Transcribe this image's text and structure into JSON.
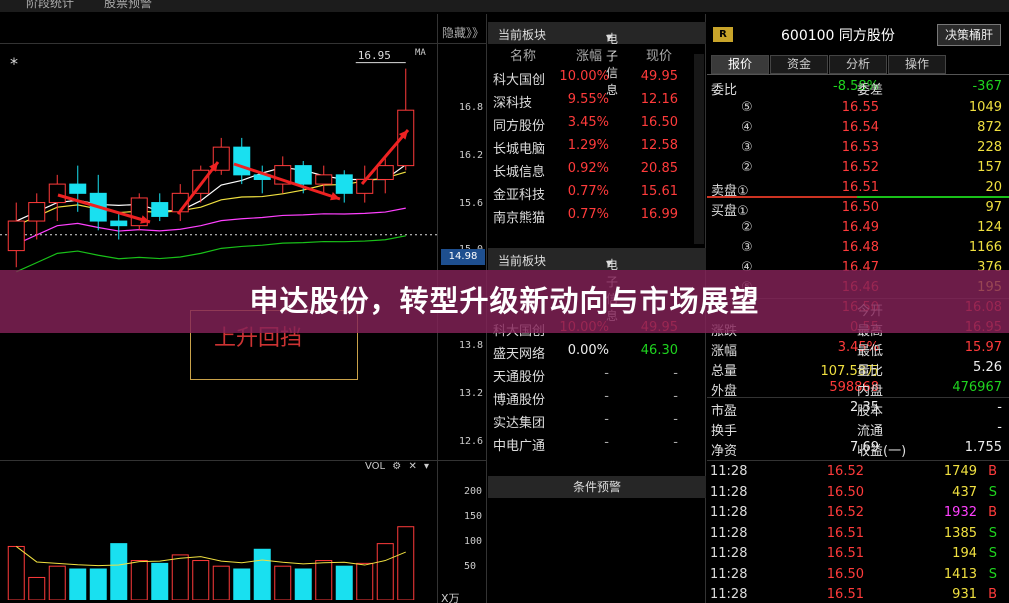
{
  "topbar": {
    "left": "阶段统计",
    "right": "股票预警"
  },
  "chart": {
    "hide_label": "隐藏》》",
    "ma_label": "MA",
    "star": "*",
    "peak_label": "16.95",
    "y_ticks": [
      "16.8",
      "16.2",
      "15.6",
      "15.0",
      "13.8",
      "13.2",
      "12.6"
    ],
    "price_flag": "14.98",
    "annotation": "上升回挡",
    "vol_label": "VOL",
    "vol_ticks": [
      "200",
      "150",
      "100",
      "50"
    ],
    "x_unit": "X万",
    "colors": {
      "up": "#ff3b3b",
      "down": "#19e0f0",
      "ma5": "#ffffff",
      "ma10": "#f0e040",
      "ma20": "#ff40ff",
      "ma60": "#19c019"
    }
  },
  "chart_data": {
    "type": "candlestick",
    "candles": [
      {
        "o": 14.98,
        "h": 15.5,
        "l": 14.8,
        "c": 15.3
      },
      {
        "o": 15.3,
        "h": 15.6,
        "l": 15.1,
        "c": 15.5
      },
      {
        "o": 15.5,
        "h": 15.8,
        "l": 15.3,
        "c": 15.7
      },
      {
        "o": 15.7,
        "h": 15.9,
        "l": 15.4,
        "c": 15.6
      },
      {
        "o": 15.6,
        "h": 15.8,
        "l": 15.2,
        "c": 15.3
      },
      {
        "o": 15.3,
        "h": 15.4,
        "l": 15.1,
        "c": 15.25
      },
      {
        "o": 15.25,
        "h": 15.6,
        "l": 15.2,
        "c": 15.55
      },
      {
        "o": 15.5,
        "h": 15.6,
        "l": 15.3,
        "c": 15.35
      },
      {
        "o": 15.4,
        "h": 15.7,
        "l": 15.3,
        "c": 15.6
      },
      {
        "o": 15.6,
        "h": 15.9,
        "l": 15.5,
        "c": 15.85
      },
      {
        "o": 15.85,
        "h": 16.2,
        "l": 15.8,
        "c": 16.1
      },
      {
        "o": 16.1,
        "h": 16.2,
        "l": 15.7,
        "c": 15.8
      },
      {
        "o": 15.8,
        "h": 15.9,
        "l": 15.6,
        "c": 15.75
      },
      {
        "o": 15.7,
        "h": 16.0,
        "l": 15.6,
        "c": 15.9
      },
      {
        "o": 15.9,
        "h": 15.95,
        "l": 15.6,
        "c": 15.7
      },
      {
        "o": 15.7,
        "h": 15.9,
        "l": 15.6,
        "c": 15.8
      },
      {
        "o": 15.8,
        "h": 15.85,
        "l": 15.5,
        "c": 15.6
      },
      {
        "o": 15.6,
        "h": 15.9,
        "l": 15.5,
        "c": 15.75
      },
      {
        "o": 15.75,
        "h": 16.0,
        "l": 15.6,
        "c": 15.9
      },
      {
        "o": 15.9,
        "h": 16.95,
        "l": 15.85,
        "c": 16.5
      }
    ],
    "volumes": [
      95,
      40,
      60,
      55,
      55,
      100,
      70,
      65,
      80,
      70,
      60,
      55,
      90,
      60,
      55,
      70,
      60,
      65,
      100,
      130
    ],
    "ylim": [
      14.9,
      17.0
    ],
    "vol_ylim": [
      0,
      220
    ]
  },
  "sector_top": {
    "header_left": "当前板块",
    "header_right": "电子信息",
    "columns": [
      "名称",
      "涨幅",
      "现价"
    ],
    "rows": [
      {
        "name": "科大国创",
        "chg": "10.00%",
        "price": "49.95"
      },
      {
        "name": "深科技",
        "chg": "9.55%",
        "price": "12.16"
      },
      {
        "name": "同方股份",
        "chg": "3.45%",
        "price": "16.50"
      },
      {
        "name": "长城电脑",
        "chg": "1.29%",
        "price": "12.58"
      },
      {
        "name": "长城信息",
        "chg": "0.92%",
        "price": "20.85"
      },
      {
        "name": "金亚科技",
        "chg": "0.77%",
        "price": "15.61"
      },
      {
        "name": "南京熊猫",
        "chg": "0.77%",
        "price": "16.99"
      }
    ]
  },
  "sector_bottom": {
    "header_left": "当前板块",
    "header_right": "电子信息",
    "rows": [
      {
        "name": "科大国创",
        "chg": "10.00%",
        "price": "49.95",
        "dir": "up"
      },
      {
        "name": "盛天网络",
        "chg": "0.00%",
        "price": "46.30",
        "dir": "flat"
      },
      {
        "name": "天通股份",
        "chg": "-",
        "price": "-",
        "dir": "none"
      },
      {
        "name": "博通股份",
        "chg": "-",
        "price": "-",
        "dir": "none"
      },
      {
        "name": "实达集团",
        "chg": "-",
        "price": "-",
        "dir": "none"
      },
      {
        "name": "中电广通",
        "chg": "-",
        "price": "-",
        "dir": "none"
      }
    ]
  },
  "alert_header": "条件预警",
  "quote": {
    "badge": "R",
    "code_name": "600100 同方股份",
    "decision_btn": "决策桶肝",
    "tabs": [
      "报价",
      "资金",
      "分析",
      "操作"
    ],
    "weibi": {
      "label": "委比",
      "value": "-8.58%",
      "label2": "委差",
      "value2": "-367"
    },
    "sell": [
      {
        "n": "⑤",
        "price": "16.55",
        "vol": "1049"
      },
      {
        "n": "④",
        "price": "16.54",
        "vol": "872"
      },
      {
        "n": "③",
        "price": "16.53",
        "vol": "228"
      },
      {
        "n": "②",
        "price": "16.52",
        "vol": "157"
      },
      {
        "n": "卖盘①",
        "price": "16.51",
        "vol": "20"
      }
    ],
    "buy": [
      {
        "n": "买盘①",
        "price": "16.50",
        "vol": "97"
      },
      {
        "n": "②",
        "price": "16.49",
        "vol": "124"
      },
      {
        "n": "③",
        "price": "16.48",
        "vol": "1166"
      },
      {
        "n": "④",
        "price": "16.47",
        "vol": "376"
      },
      {
        "n": "⑤",
        "price": "16.46",
        "vol": "195"
      }
    ],
    "stats": [
      {
        "l": "",
        "v": "16.50",
        "l2": "今开",
        "v2": "16.08",
        "c1": "red",
        "c2": "red"
      },
      {
        "l": "涨跌",
        "v": "0.55",
        "l2": "最高",
        "v2": "16.95",
        "c1": "red",
        "c2": "red"
      },
      {
        "l": "涨幅",
        "v": "3.45%",
        "l2": "最低",
        "v2": "15.97",
        "c1": "red",
        "c2": "red"
      },
      {
        "l": "总量",
        "v": "107.58万",
        "l2": "量比",
        "v2": "5.26",
        "c1": "yellow",
        "c2": "white"
      },
      {
        "l": "外盘",
        "v": "598868",
        "l2": "内盘",
        "v2": "476967",
        "c1": "red",
        "c2": "green"
      },
      {
        "l": "市盈",
        "v": "2.35",
        "l2": "股本",
        "v2": "-",
        "c1": "white",
        "c2": "white"
      },
      {
        "l": "换手",
        "v": "-",
        "l2": "流通",
        "v2": "-",
        "c1": "white",
        "c2": "white"
      },
      {
        "l": "净资",
        "v": "7.69",
        "l2": "收益(一)",
        "v2": "1.755",
        "c1": "white",
        "c2": "white"
      }
    ],
    "ticks": [
      {
        "t": "11:28",
        "p": "16.52",
        "v": "1749",
        "s": "B",
        "vc": "yellow"
      },
      {
        "t": "11:28",
        "p": "16.50",
        "v": "437",
        "s": "S",
        "vc": "yellow"
      },
      {
        "t": "11:28",
        "p": "16.52",
        "v": "1932",
        "s": "B",
        "vc": "magenta"
      },
      {
        "t": "11:28",
        "p": "16.51",
        "v": "1385",
        "s": "S",
        "vc": "yellow"
      },
      {
        "t": "11:28",
        "p": "16.51",
        "v": "194",
        "s": "S",
        "vc": "yellow"
      },
      {
        "t": "11:28",
        "p": "16.50",
        "v": "1413",
        "s": "S",
        "vc": "yellow"
      },
      {
        "t": "11:28",
        "p": "16.51",
        "v": "931",
        "s": "B",
        "vc": "yellow"
      }
    ]
  },
  "banner": {
    "title": "申达股份，转型升级新动向与市场展望"
  }
}
